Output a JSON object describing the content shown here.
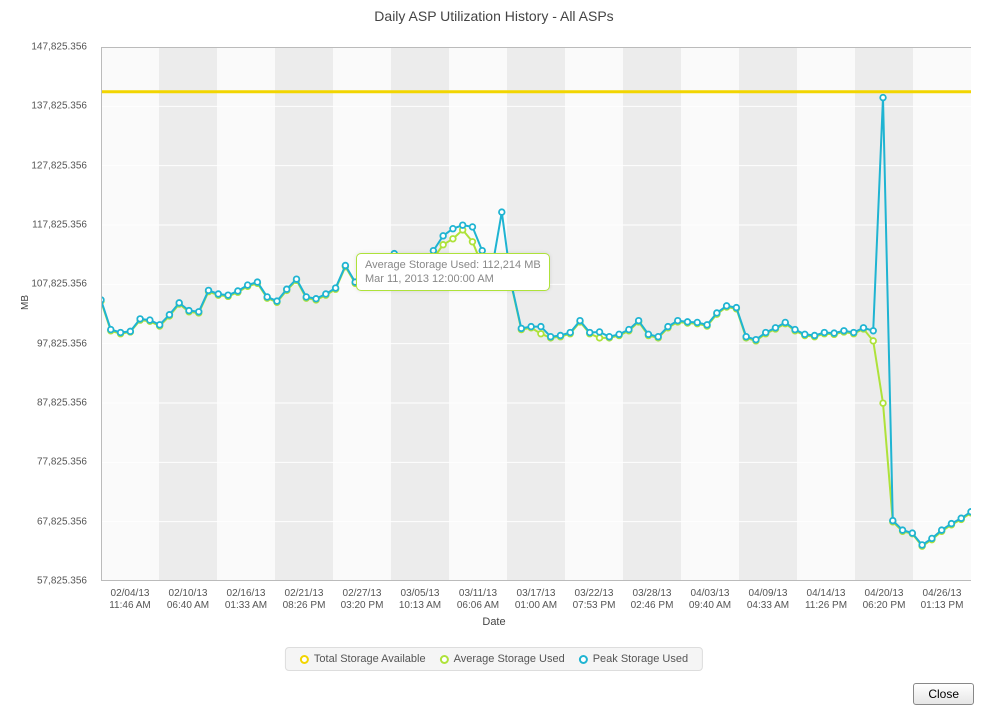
{
  "chart_data": {
    "type": "line",
    "title": "Daily ASP Utilization History  - All ASPs",
    "xlabel": "Date",
    "ylabel": "MB",
    "ylim": [
      57825.356,
      147825.356
    ],
    "y_ticks": [
      "57,825.356",
      "67,825.356",
      "77,825.356",
      "87,825.356",
      "97,825.356",
      "107,825.356",
      "117,825.356",
      "127,825.356",
      "137,825.356",
      "147,825.356"
    ],
    "x_ticks": [
      {
        "d": "02/04/13",
        "t": "11:46 AM"
      },
      {
        "d": "02/10/13",
        "t": "06:40 AM"
      },
      {
        "d": "02/16/13",
        "t": "01:33 AM"
      },
      {
        "d": "02/21/13",
        "t": "08:26 PM"
      },
      {
        "d": "02/27/13",
        "t": "03:20 PM"
      },
      {
        "d": "03/05/13",
        "t": "10:13 AM"
      },
      {
        "d": "03/11/13",
        "t": "06:06 AM"
      },
      {
        "d": "03/17/13",
        "t": "01:00 AM"
      },
      {
        "d": "03/22/13",
        "t": "07:53 PM"
      },
      {
        "d": "03/28/13",
        "t": "02:46 PM"
      },
      {
        "d": "04/03/13",
        "t": "09:40 AM"
      },
      {
        "d": "04/09/13",
        "t": "04:33 AM"
      },
      {
        "d": "04/14/13",
        "t": "11:26 PM"
      },
      {
        "d": "04/20/13",
        "t": "06:20 PM"
      },
      {
        "d": "04/26/13",
        "t": "01:13 PM"
      }
    ],
    "series": [
      {
        "name": "Total Storage Available",
        "color": "#f2d500",
        "values": [
          140300,
          140300,
          140300,
          140300,
          140300,
          140300,
          140300,
          140300,
          140300,
          140300,
          140300,
          140300,
          140300,
          140300,
          140300,
          140300,
          140300,
          140300,
          140300,
          140300,
          140300,
          140300,
          140300,
          140300,
          140300,
          140300,
          140300,
          140300,
          140300,
          140300,
          140300,
          140300,
          140300,
          140300,
          140300,
          140300,
          140300,
          140300,
          140300,
          140300,
          140300,
          140300,
          140300,
          140300,
          140300,
          140300,
          140300,
          140300,
          140300,
          140300,
          140300,
          140300,
          140300,
          140300,
          140300,
          140300,
          140300,
          140300,
          140300,
          140300,
          140300,
          140300,
          140300,
          140300,
          140300,
          140300,
          140300,
          140300,
          140300,
          140300,
          140300,
          140300,
          140300,
          140300,
          140300,
          140300,
          140300,
          140300,
          140300,
          140300,
          140300,
          140300,
          140300,
          140300,
          140300,
          140300,
          140300,
          140300,
          140300,
          140300
        ]
      },
      {
        "name": "Average Storage Used",
        "color": "#aee23a",
        "values": [
          105000,
          100000,
          99500,
          99800,
          101800,
          101600,
          100800,
          102500,
          104500,
          103200,
          103000,
          106600,
          106000,
          105800,
          106500,
          107500,
          108000,
          105500,
          104800,
          106800,
          108500,
          105500,
          105200,
          106000,
          107000,
          110800,
          108000,
          108000,
          108800,
          111000,
          112800,
          111000,
          108500,
          110000,
          112214,
          114500,
          115500,
          117000,
          115000,
          111000,
          110300,
          108200,
          107500,
          100200,
          100500,
          99500,
          98800,
          99000,
          99500,
          101500,
          99500,
          98800,
          98800,
          99200,
          100000,
          101500,
          99200,
          98800,
          100500,
          101500,
          101300,
          101200,
          100800,
          102800,
          104000,
          103700,
          98800,
          98300,
          99500,
          100300,
          101200,
          100000,
          99200,
          99000,
          99500,
          99400,
          99800,
          99500,
          100300,
          98300,
          87800,
          67800,
          66200,
          65800,
          63700,
          64800,
          66200,
          67300,
          68200,
          69300
        ]
      },
      {
        "name": "Peak Storage Used",
        "color": "#1fb4d2",
        "values": [
          105200,
          100200,
          99700,
          99900,
          102000,
          101800,
          101000,
          102700,
          104700,
          103400,
          103200,
          106800,
          106200,
          106000,
          106700,
          107700,
          108200,
          105700,
          105000,
          107000,
          108700,
          105700,
          105400,
          106200,
          107200,
          111000,
          108200,
          108200,
          109000,
          111200,
          113000,
          111200,
          108700,
          110200,
          113500,
          116000,
          117200,
          117800,
          117500,
          113500,
          110500,
          120000,
          107700,
          100400,
          100700,
          100700,
          99000,
          99200,
          99700,
          101700,
          99700,
          99800,
          99000,
          99400,
          100200,
          101700,
          99400,
          99000,
          100700,
          101700,
          101500,
          101400,
          101000,
          103000,
          104200,
          103900,
          99000,
          98500,
          99700,
          100500,
          101400,
          100200,
          99400,
          99200,
          99700,
          99600,
          100000,
          99700,
          100500,
          100000,
          139300,
          68000,
          66400,
          65900,
          63900,
          65000,
          66400,
          67500,
          68400,
          69500
        ]
      }
    ]
  },
  "legend": [
    "Total Storage Available",
    "Average Storage Used",
    "Peak Storage Used"
  ],
  "tooltip": {
    "l1": "Average Storage Used: 112,214 MB",
    "l2": "Mar 11, 2013 12:00:00 AM"
  },
  "close": "Close"
}
